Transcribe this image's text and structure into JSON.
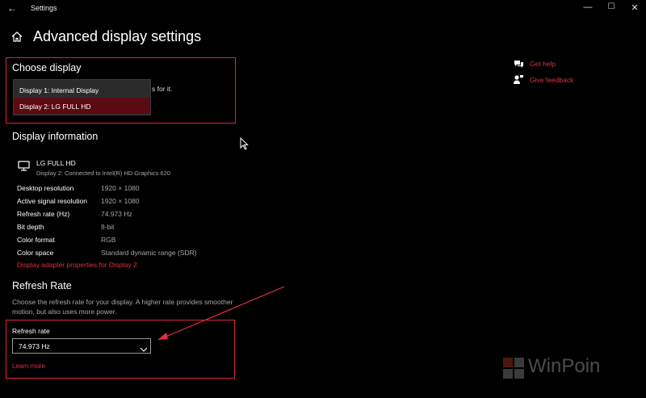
{
  "window": {
    "title": "Settings",
    "back_glyph": "←",
    "min_glyph": "—",
    "max_glyph": "☐",
    "close_glyph": "✕"
  },
  "page": {
    "title": "Advanced display settings"
  },
  "choose_display": {
    "title": "Choose display",
    "hidden_text": "s for it.",
    "options": [
      "Display 1: Internal Display",
      "Display 2: LG FULL HD"
    ],
    "selected_index": 1
  },
  "display_information": {
    "title": "Display information",
    "monitor_name": "LG FULL HD",
    "monitor_sub": "Display 2: Connected to Intel(R) HD Graphics 620",
    "rows": [
      {
        "label": "Desktop resolution",
        "value": "1920 × 1080"
      },
      {
        "label": "Active signal resolution",
        "value": "1920 × 1080"
      },
      {
        "label": "Refresh rate (Hz)",
        "value": "74.973 Hz"
      },
      {
        "label": "Bit depth",
        "value": "8-bit"
      },
      {
        "label": "Color format",
        "value": "RGB"
      },
      {
        "label": "Color space",
        "value": "Standard dynamic range (SDR)"
      }
    ],
    "adapter_link": "Display adapter properties for Display 2"
  },
  "refresh_rate": {
    "title": "Refresh Rate",
    "description": "Choose the refresh rate for your display. A higher rate provides smoother motion, but also uses more power.",
    "label": "Refresh rate",
    "value": "74.973 Hz",
    "learn_more": "Learn more"
  },
  "side": {
    "get_help": "Get help",
    "give_feedback": "Give feedback"
  },
  "watermark": {
    "text": "WinPoin"
  },
  "colors": {
    "accent": "#e0303f",
    "highlight_box": "#d8253b",
    "selected_item": "#5b0a12",
    "background": "#000000"
  }
}
